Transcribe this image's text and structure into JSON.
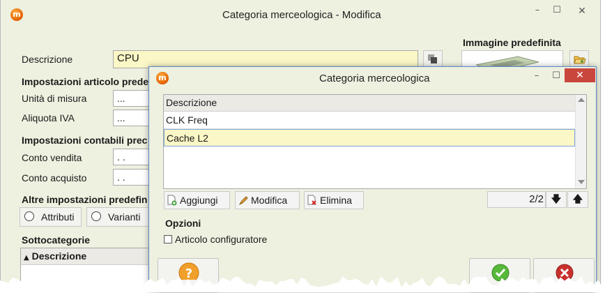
{
  "main_window": {
    "title": "Categoria merceologica - Modifica",
    "app_icon": "m",
    "minimize_glyph": "–",
    "maximize_glyph": "☐",
    "close_glyph": "✕",
    "descrizione_label": "Descrizione",
    "descrizione_value": "CPU",
    "impostazioni_articolo_label": "Impostazioni articolo prede",
    "unita_misura_label": "Unità di misura",
    "unita_misura_value": "...",
    "aliquota_iva_label": "Aliquota IVA",
    "aliquota_iva_value": "...",
    "impostazioni_contabili_label": "Impostazioni contabili prec",
    "conto_vendita_label": "Conto vendita",
    "conto_vendita_value": ".   .",
    "conto_acquisto_label": "Conto acquisto",
    "conto_acquisto_value": ".   .",
    "altre_impostazioni_label": "Altre impostazioni predefin",
    "attributi_label": "Attributi",
    "varianti_label": "Varianti",
    "sottocategorie_label": "Sottocategorie",
    "sottocategorie_col": "Descrizione",
    "sort_glyph": "▲",
    "immagine_label": "Immagine predefinita"
  },
  "dialog": {
    "title": "Categoria merceologica",
    "app_icon": "m",
    "minimize_glyph": "–",
    "maximize_glyph": "☐",
    "close_glyph": "✕",
    "grid_header": "Descrizione",
    "rows": [
      "CLK Freq",
      "Cache L2"
    ],
    "selected_row": 1,
    "aggiungi_label": "Aggiungi",
    "modifica_label": "Modifica",
    "elimina_label": "Elimina",
    "counter": "2/2",
    "down_glyph": "🡇",
    "up_glyph": "🡅",
    "opzioni_label": "Opzioni",
    "articolo_configuratore_label": "Articolo configuratore",
    "articolo_configuratore_checked": false
  },
  "colors": {
    "window_bg": "#eef1e0",
    "highlight_field": "#fbf7c6",
    "dialog_border": "#5a89c6",
    "close_red": "#c9463d"
  }
}
